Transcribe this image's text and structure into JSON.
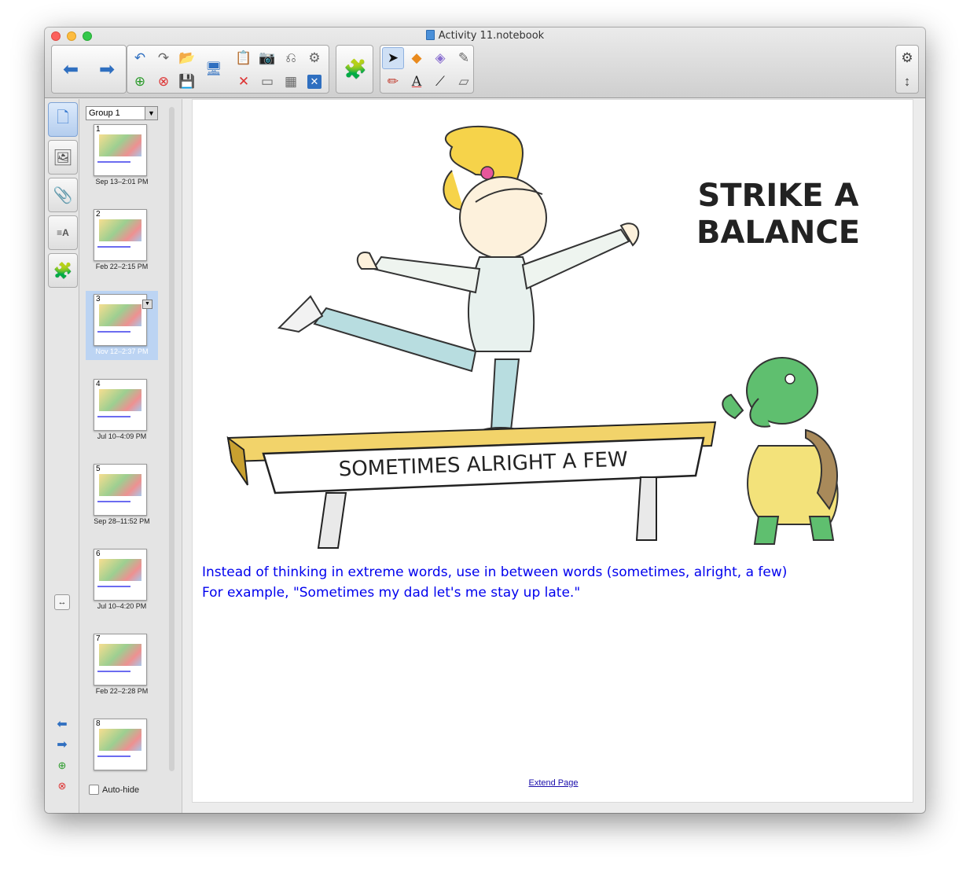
{
  "window": {
    "title": "Activity 11.notebook"
  },
  "toolbar": {
    "back_icon": "arrow-left-icon",
    "forward_icon": "arrow-right-icon",
    "buttons": [
      "undo-icon",
      "redo-icon",
      "open-folder-icon",
      "add-page-icon",
      "delete-page-icon",
      "save-icon",
      "screen-shade-icon",
      "paste-icon",
      "screen-capture-icon",
      "clear-page-icon",
      "delete-icon",
      "table-icon",
      "document-camera-icon",
      "tools-icon",
      "addons-icon",
      "select-pointer-icon",
      "shapes-icon",
      "eraser-fill-icon",
      "magic-pen-icon",
      "pens-icon",
      "text-icon",
      "line-icon",
      "eraser-icon",
      "settings-gear-icon",
      "toolbar-toggle-icon"
    ]
  },
  "sidebar": {
    "tabs": [
      "page-sorter-icon",
      "gallery-icon",
      "attachments-icon",
      "properties-icon",
      "addons-icon"
    ]
  },
  "sorter": {
    "group": "Group 1",
    "pages": [
      {
        "num": "1",
        "date": "Sep 13–2:01 PM"
      },
      {
        "num": "2",
        "date": "Feb 22–2:15 PM"
      },
      {
        "num": "3",
        "date": "Nov 12–2:37 PM"
      },
      {
        "num": "4",
        "date": "Jul 10–4:09 PM"
      },
      {
        "num": "5",
        "date": "Sep 28–11:52 PM"
      },
      {
        "num": "6",
        "date": "Jul 10–4:20 PM"
      },
      {
        "num": "7",
        "date": "Feb 22–2:28 PM"
      },
      {
        "num": "8",
        "date": ""
      }
    ],
    "autohide_label": "Auto-hide"
  },
  "canvas": {
    "cartoon_title_line1": "STRIKE A",
    "cartoon_title_line2": "BALANCE",
    "beam_text": "SOMETIMES  ALRIGHT  A  FEW",
    "line1": "Instead of thinking in extreme words, use in between words (sometimes, alright, a few)",
    "line2": "For example, \"Sometimes my dad let's me stay up late.\"",
    "extend_link": "Extend Page"
  },
  "colors": {
    "body_text": "#0000ee",
    "selection": "#bcd4f3",
    "accent": "#2f6fc0"
  }
}
